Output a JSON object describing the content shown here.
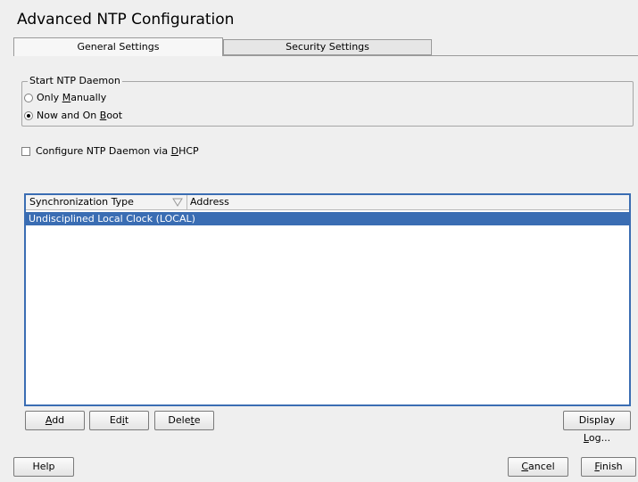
{
  "page": {
    "title": "Advanced NTP Configuration"
  },
  "tabs": [
    {
      "label": "General Settings",
      "active": true
    },
    {
      "label": "Security Settings",
      "active": false
    }
  ],
  "daemon_group": {
    "legend": "Start NTP Daemon",
    "options": [
      {
        "label_pre": "Only ",
        "label_mnemonic": "M",
        "label_post": "anually",
        "selected": false
      },
      {
        "label_pre": "Now and On ",
        "label_mnemonic": "B",
        "label_post": "oot",
        "selected": true
      }
    ]
  },
  "dhcp_checkbox": {
    "label_pre": "Configure NTP Daemon via ",
    "label_mnemonic": "D",
    "label_post": "HCP",
    "checked": false
  },
  "table": {
    "columns": [
      "Synchronization Type",
      "Address"
    ],
    "rows": [
      {
        "type": "Undisciplined Local Clock (LOCAL)",
        "address": "",
        "selected": true
      }
    ],
    "selection_color": "#3a6db3"
  },
  "buttons": {
    "add": {
      "mnemonic": "A",
      "rest": "dd"
    },
    "edit": {
      "pre": "Ed",
      "mnemonic": "i",
      "post": "t"
    },
    "delete": {
      "pre": "Dele",
      "mnemonic": "t",
      "post": "e"
    },
    "display_log": {
      "pre": "Display ",
      "mnemonic": "L",
      "post": "og..."
    },
    "help": "Help",
    "cancel": {
      "mnemonic": "C",
      "rest": "ancel"
    },
    "finish": {
      "mnemonic": "F",
      "rest": "inish"
    }
  }
}
